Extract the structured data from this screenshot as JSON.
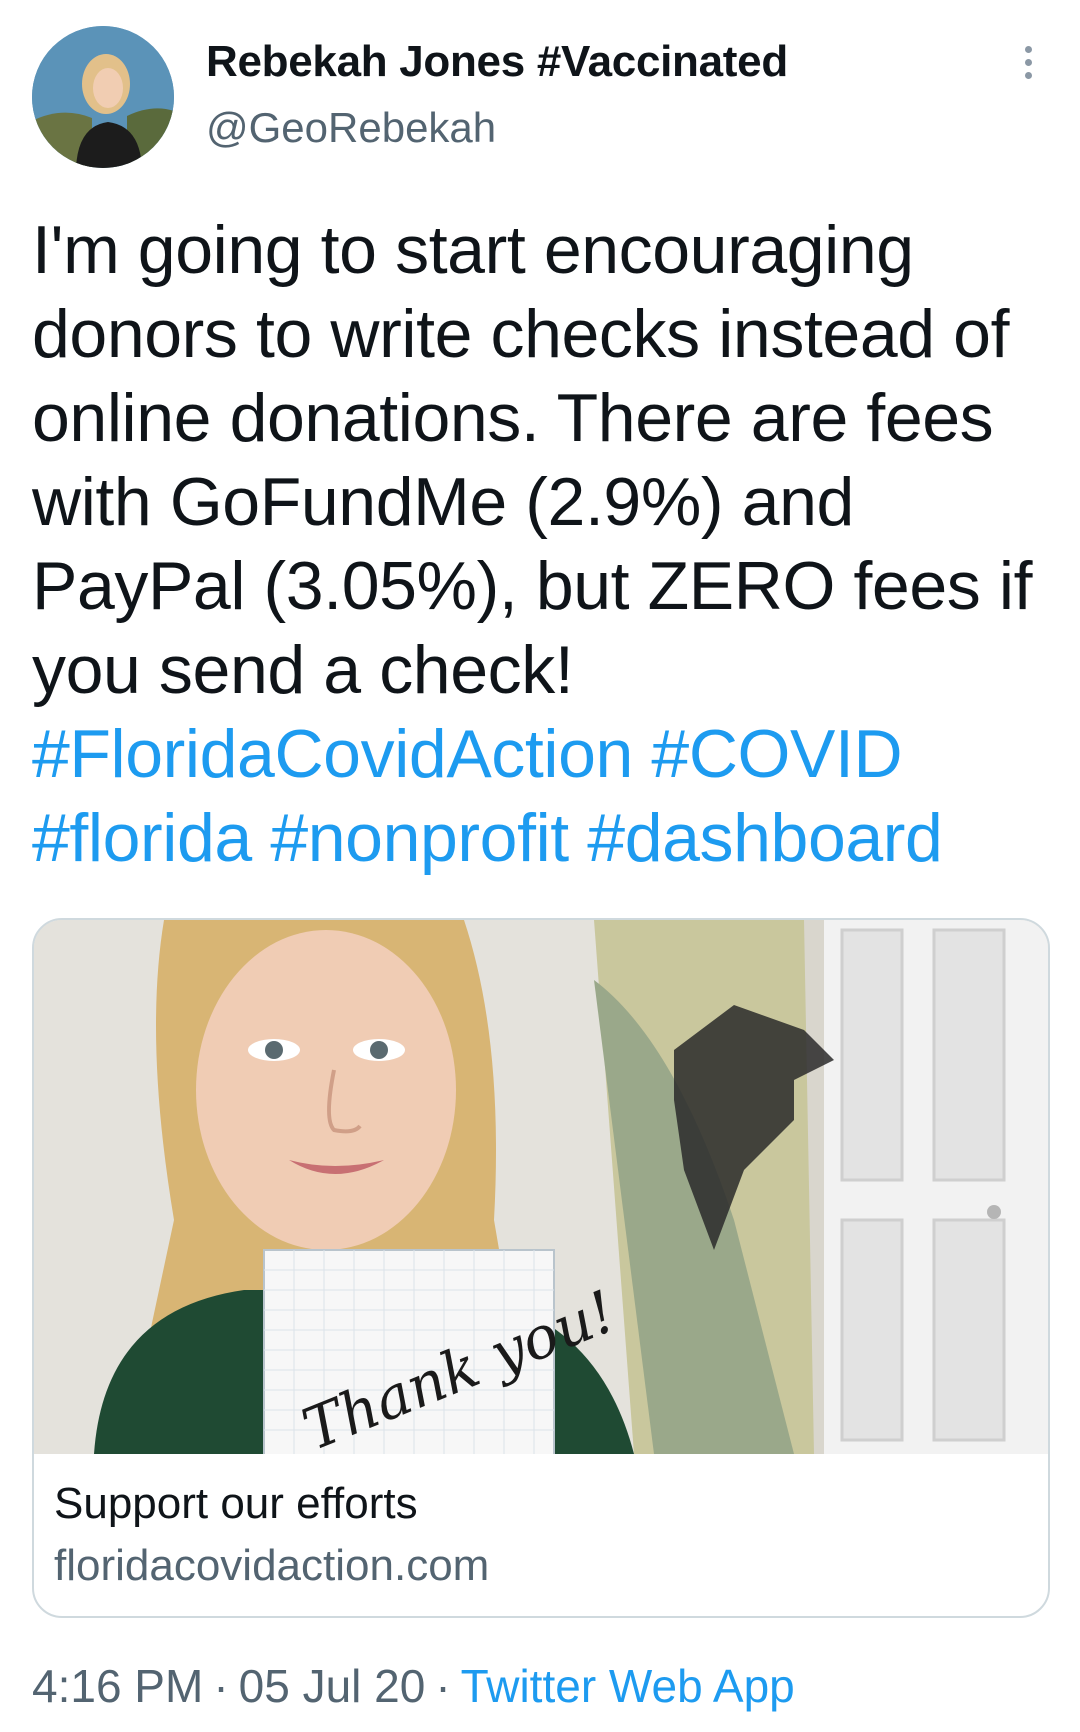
{
  "author": {
    "display_name": "Rebekah Jones #Vaccinated",
    "handle": "@GeoRebekah",
    "avatar_icon": "profile-photo"
  },
  "more_icon": "more-vertical-icon",
  "tweet": {
    "segments": [
      {
        "text": "I'm going to start encouraging donors to write checks instead of online donations. There are fees with GoFundMe (2.9%) and PayPal (3.05%), but ZERO fees if you send a check! ",
        "type": "text"
      },
      {
        "text": "#FloridaCovidAction",
        "type": "hashtag"
      },
      {
        "text": " ",
        "type": "text"
      },
      {
        "text": "#COVID",
        "type": "hashtag"
      },
      {
        "text": " ",
        "type": "text"
      },
      {
        "text": "#florida",
        "type": "hashtag"
      },
      {
        "text": " ",
        "type": "text"
      },
      {
        "text": "#nonprofit",
        "type": "hashtag"
      },
      {
        "text": " ",
        "type": "text"
      },
      {
        "text": "#dashboard",
        "type": "hashtag"
      }
    ]
  },
  "link_card": {
    "title": "Support our efforts",
    "domain": "floridacovidaction.com",
    "image_handwriting": "Thank you!"
  },
  "meta": {
    "time": "4:16 PM",
    "date": "05 Jul 20",
    "source": "Twitter Web App",
    "separator": "·"
  },
  "colors": {
    "link": "#1d9bf0",
    "secondary_text": "#536471",
    "primary_text": "#0f1419",
    "border": "#cfd9de"
  }
}
